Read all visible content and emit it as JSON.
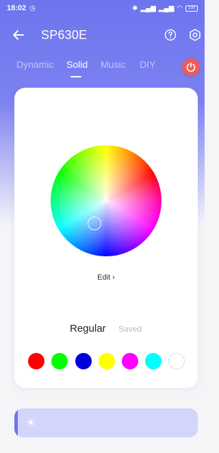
{
  "status": {
    "time": "18:02",
    "battery": "100"
  },
  "header": {
    "title": "SP630E"
  },
  "tabs": [
    {
      "label": "Dynamic",
      "active": false
    },
    {
      "label": "Solid",
      "active": true
    },
    {
      "label": "Music",
      "active": false
    },
    {
      "label": "DIY",
      "active": false
    }
  ],
  "card": {
    "edit_label": "Edit ›",
    "mode_regular": "Regular",
    "mode_saved": "Saved"
  },
  "swatch_colors": [
    "#ff0000",
    "#00ff00",
    "#0000dd",
    "#ffff00",
    "#ff00ff",
    "#00ffff",
    "#ffffff"
  ],
  "brightness": {
    "level": 0.02
  },
  "colors": {
    "accent": "#6d74ee",
    "power": "#ef5b5b"
  },
  "icons": {
    "back": "back-arrow-icon",
    "help": "help-icon",
    "settings": "settings-icon",
    "power": "power-icon",
    "brightness": "sun-icon"
  }
}
